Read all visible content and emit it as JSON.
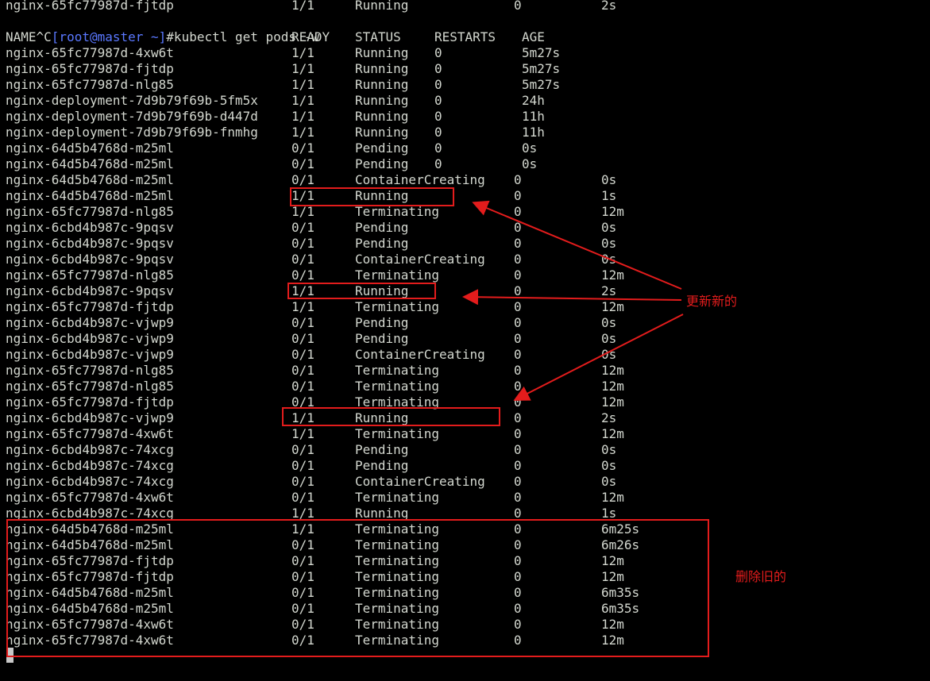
{
  "top_line": {
    "name": "nginx-65fc77987d-fjtdp",
    "ready": "1/1",
    "status": "Running",
    "restarts": "0",
    "age": "2s"
  },
  "prompt": {
    "interrupt": "^C",
    "user_host": "[root@master ~]",
    "command": "#kubectl get pods -w"
  },
  "headers": {
    "name": "NAME",
    "ready": "READY",
    "status": "STATUS",
    "restarts": "RESTARTS",
    "age": "AGE"
  },
  "rows": [
    {
      "name": "nginx-65fc77987d-4xw6t",
      "ready": "1/1",
      "status": "Running",
      "restarts": "0",
      "age": "5m27s"
    },
    {
      "name": "nginx-65fc77987d-fjtdp",
      "ready": "1/1",
      "status": "Running",
      "restarts": "0",
      "age": "5m27s"
    },
    {
      "name": "nginx-65fc77987d-nlg85",
      "ready": "1/1",
      "status": "Running",
      "restarts": "0",
      "age": "5m27s"
    },
    {
      "name": "nginx-deployment-7d9b79f69b-5fm5x",
      "ready": "1/1",
      "status": "Running",
      "restarts": "0",
      "age": "24h"
    },
    {
      "name": "nginx-deployment-7d9b79f69b-d447d",
      "ready": "1/1",
      "status": "Running",
      "restarts": "0",
      "age": "11h"
    },
    {
      "name": "nginx-deployment-7d9b79f69b-fnmhg",
      "ready": "1/1",
      "status": "Running",
      "restarts": "0",
      "age": "11h"
    },
    {
      "name": "nginx-64d5b4768d-m25ml",
      "ready": "0/1",
      "status": "Pending",
      "restarts": "0",
      "age": "0s"
    },
    {
      "name": "nginx-64d5b4768d-m25ml",
      "ready": "0/1",
      "status": "Pending",
      "restarts": "0",
      "age": "0s"
    },
    {
      "name": "nginx-64d5b4768d-m25ml",
      "ready": "0/1",
      "status": "ContainerCreating",
      "restarts": "0",
      "age": "0s"
    },
    {
      "name": "nginx-64d5b4768d-m25ml",
      "ready": "1/1",
      "status": "Running",
      "restarts": "0",
      "age": "1s"
    },
    {
      "name": "nginx-65fc77987d-nlg85",
      "ready": "1/1",
      "status": "Terminating",
      "restarts": "0",
      "age": "12m"
    },
    {
      "name": "nginx-6cbd4b987c-9pqsv",
      "ready": "0/1",
      "status": "Pending",
      "restarts": "0",
      "age": "0s"
    },
    {
      "name": "nginx-6cbd4b987c-9pqsv",
      "ready": "0/1",
      "status": "Pending",
      "restarts": "0",
      "age": "0s"
    },
    {
      "name": "nginx-6cbd4b987c-9pqsv",
      "ready": "0/1",
      "status": "ContainerCreating",
      "restarts": "0",
      "age": "0s"
    },
    {
      "name": "nginx-65fc77987d-nlg85",
      "ready": "0/1",
      "status": "Terminating",
      "restarts": "0",
      "age": "12m"
    },
    {
      "name": "nginx-6cbd4b987c-9pqsv",
      "ready": "1/1",
      "status": "Running",
      "restarts": "0",
      "age": "2s"
    },
    {
      "name": "nginx-65fc77987d-fjtdp",
      "ready": "1/1",
      "status": "Terminating",
      "restarts": "0",
      "age": "12m"
    },
    {
      "name": "nginx-6cbd4b987c-vjwp9",
      "ready": "0/1",
      "status": "Pending",
      "restarts": "0",
      "age": "0s"
    },
    {
      "name": "nginx-6cbd4b987c-vjwp9",
      "ready": "0/1",
      "status": "Pending",
      "restarts": "0",
      "age": "0s"
    },
    {
      "name": "nginx-6cbd4b987c-vjwp9",
      "ready": "0/1",
      "status": "ContainerCreating",
      "restarts": "0",
      "age": "0s"
    },
    {
      "name": "nginx-65fc77987d-nlg85",
      "ready": "0/1",
      "status": "Terminating",
      "restarts": "0",
      "age": "12m"
    },
    {
      "name": "nginx-65fc77987d-nlg85",
      "ready": "0/1",
      "status": "Terminating",
      "restarts": "0",
      "age": "12m"
    },
    {
      "name": "nginx-65fc77987d-fjtdp",
      "ready": "0/1",
      "status": "Terminating",
      "restarts": "0",
      "age": "12m"
    },
    {
      "name": "nginx-6cbd4b987c-vjwp9",
      "ready": "1/1",
      "status": "Running",
      "restarts": "0",
      "age": "2s"
    },
    {
      "name": "nginx-65fc77987d-4xw6t",
      "ready": "1/1",
      "status": "Terminating",
      "restarts": "0",
      "age": "12m"
    },
    {
      "name": "nginx-6cbd4b987c-74xcg",
      "ready": "0/1",
      "status": "Pending",
      "restarts": "0",
      "age": "0s"
    },
    {
      "name": "nginx-6cbd4b987c-74xcg",
      "ready": "0/1",
      "status": "Pending",
      "restarts": "0",
      "age": "0s"
    },
    {
      "name": "nginx-6cbd4b987c-74xcg",
      "ready": "0/1",
      "status": "ContainerCreating",
      "restarts": "0",
      "age": "0s"
    },
    {
      "name": "nginx-65fc77987d-4xw6t",
      "ready": "0/1",
      "status": "Terminating",
      "restarts": "0",
      "age": "12m"
    },
    {
      "name": "nginx-6cbd4b987c-74xcg",
      "ready": "1/1",
      "status": "Running",
      "restarts": "0",
      "age": "1s"
    },
    {
      "name": "nginx-64d5b4768d-m25ml",
      "ready": "1/1",
      "status": "Terminating",
      "restarts": "0",
      "age": "6m25s"
    },
    {
      "name": "nginx-64d5b4768d-m25ml",
      "ready": "0/1",
      "status": "Terminating",
      "restarts": "0",
      "age": "6m26s"
    },
    {
      "name": "nginx-65fc77987d-fjtdp",
      "ready": "0/1",
      "status": "Terminating",
      "restarts": "0",
      "age": "12m"
    },
    {
      "name": "nginx-65fc77987d-fjtdp",
      "ready": "0/1",
      "status": "Terminating",
      "restarts": "0",
      "age": "12m"
    },
    {
      "name": "nginx-64d5b4768d-m25ml",
      "ready": "0/1",
      "status": "Terminating",
      "restarts": "0",
      "age": "6m35s"
    },
    {
      "name": "nginx-64d5b4768d-m25ml",
      "ready": "0/1",
      "status": "Terminating",
      "restarts": "0",
      "age": "6m35s"
    },
    {
      "name": "nginx-65fc77987d-4xw6t",
      "ready": "0/1",
      "status": "Terminating",
      "restarts": "0",
      "age": "12m"
    },
    {
      "name": "nginx-65fc77987d-4xw6t",
      "ready": "0/1",
      "status": "Terminating",
      "restarts": "0",
      "age": "12m"
    }
  ],
  "annotations": {
    "update_new": "更新新的",
    "delete_old": "删除旧的",
    "color": "#e31c1c"
  },
  "theme": {
    "background": "#000000",
    "text": "#d3d7cf",
    "prompt_host": "#5a78ff"
  }
}
